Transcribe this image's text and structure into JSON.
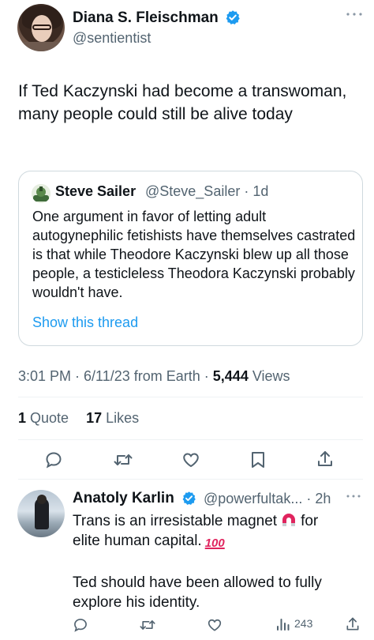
{
  "main_tweet": {
    "author_name": "Diana S. Fleischman",
    "author_handle": "@sentientist",
    "text": "If Ted Kaczynski had become a transwoman, many people could still be alive today",
    "quote": {
      "author_name": "Steve Sailer",
      "author_handle": "@Steve_Sailer · 1d",
      "text": "One argument in favor of letting adult autogynephilic fetishists have themselves castrated is that while Theodore Kaczynski blew up all those people, a testicleless Theodora Kaczynski probably wouldn't have.",
      "show_thread_label": "Show this thread"
    },
    "meta": {
      "time_date_source": "3:01 PM · 6/11/23 from Earth · ",
      "views_count": "5,444",
      "views_label": " Views"
    },
    "stats": {
      "quotes_count": "1",
      "quotes_label": " Quote",
      "likes_count": "17",
      "likes_label": " Likes"
    }
  },
  "reply": {
    "author_name": "Anatoly Karlin",
    "author_handle": "@powerfultak... · 2h",
    "text_line1_before": "Trans is an irresistable magnet",
    "text_line1_after": "for",
    "text_line2": "elite human capital.",
    "hundred_emoji": "100",
    "text_paragraph2": "Ted should have been allowed to fully explore his identity.",
    "views_count": "243"
  },
  "colors": {
    "accent": "#1d9bf0",
    "secondary_text": "#536471",
    "border": "#cfd9de",
    "divider": "#eff3f4"
  },
  "icons": [
    "verified-badge-icon",
    "more-icon",
    "reply-icon",
    "retweet-icon",
    "like-icon",
    "bookmark-icon",
    "share-icon",
    "views-icon",
    "magnet-icon",
    "hundred-points-icon"
  ]
}
